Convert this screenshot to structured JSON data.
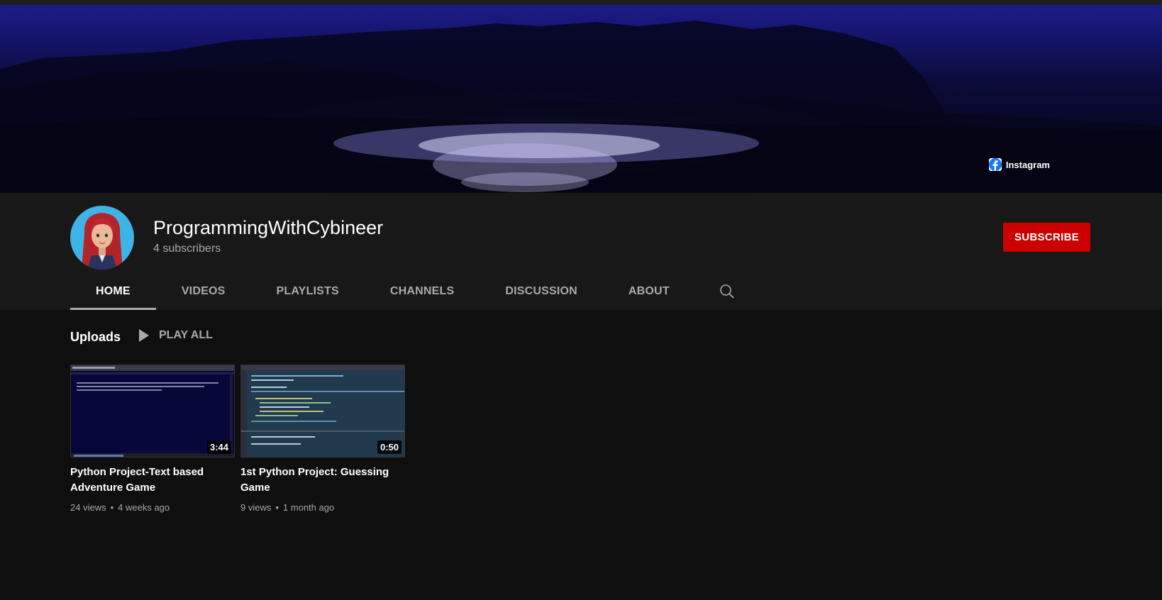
{
  "banner": {
    "links": [
      {
        "label": "Instagram",
        "icon": "instagram-icon"
      },
      {
        "icon": "twitter-icon"
      },
      {
        "icon": "github-icon"
      },
      {
        "icon": "website-icon"
      },
      {
        "icon": "facebook-icon"
      }
    ]
  },
  "channel": {
    "name": "ProgrammingWithCybineer",
    "subscribers": "4 subscribers",
    "subscribe_label": "SUBSCRIBE",
    "subscribe_color": "#cc0000"
  },
  "tabs": [
    {
      "label": "HOME",
      "active": true
    },
    {
      "label": "VIDEOS"
    },
    {
      "label": "PLAYLISTS"
    },
    {
      "label": "CHANNELS"
    },
    {
      "label": "DISCUSSION"
    },
    {
      "label": "ABOUT"
    }
  ],
  "uploads": {
    "title": "Uploads",
    "play_all": "PLAY ALL",
    "videos": [
      {
        "title": "Python Project-Text based Adventure Game",
        "duration": "3:44",
        "views": "24 views",
        "age": "4 weeks ago"
      },
      {
        "title": "1st Python Project: Guessing Game",
        "duration": "0:50",
        "views": "9 views",
        "age": "1 month ago"
      }
    ]
  }
}
